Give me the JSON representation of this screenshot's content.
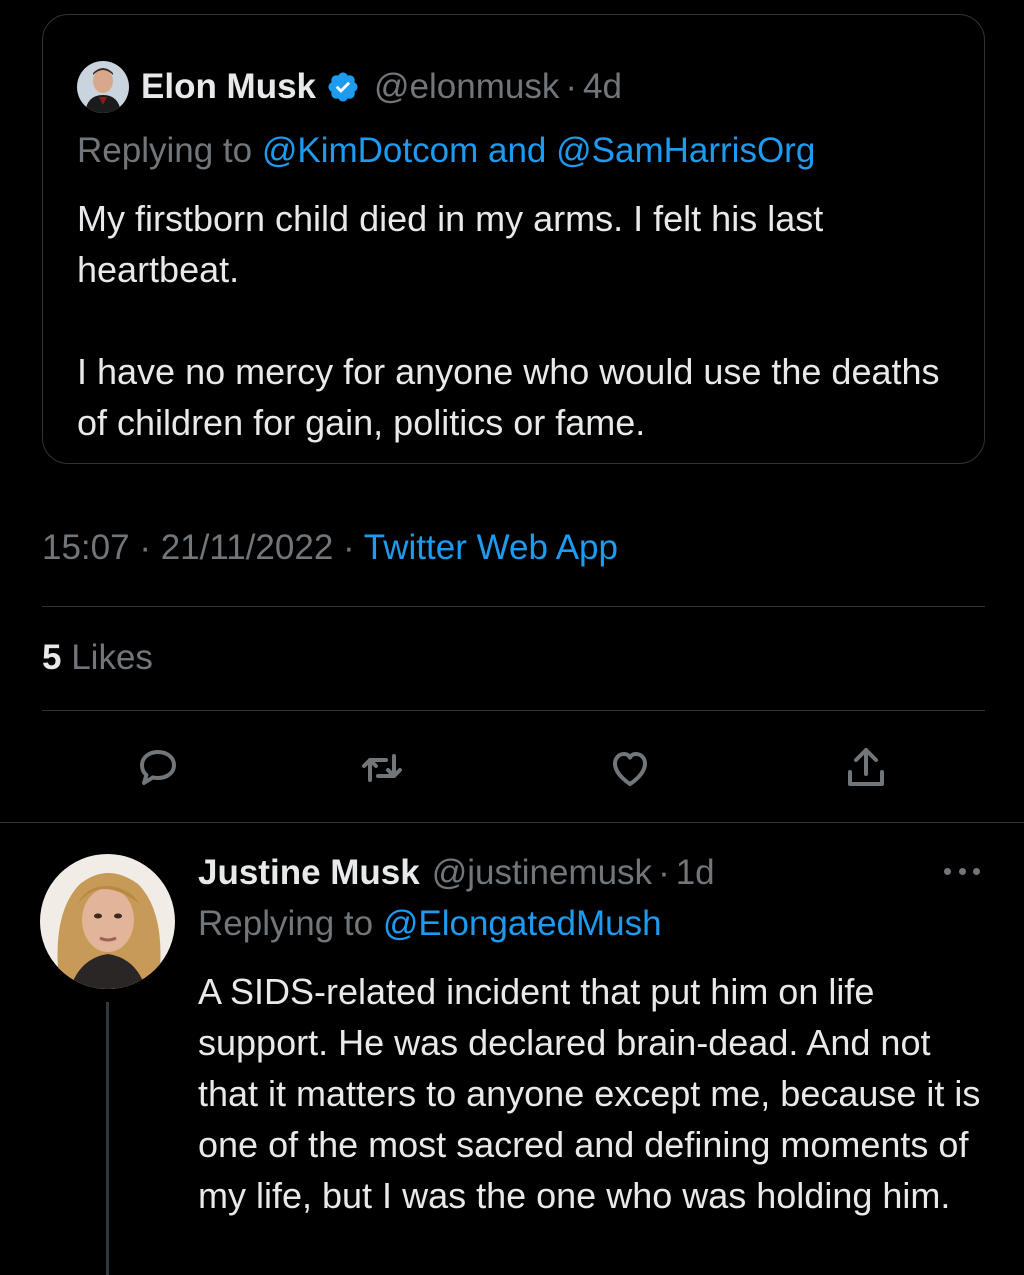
{
  "quoted_tweet": {
    "author_name": "Elon Musk",
    "handle": "@elonmusk",
    "separator": "·",
    "time_ago": "4d",
    "replying_prefix": "Replying to",
    "replying_to_1": "@KimDotcom",
    "replying_and": "and",
    "replying_to_2": "@SamHarrisOrg",
    "paragraph_1": "My firstborn child died in my arms. I felt his last heartbeat.",
    "paragraph_2": "I have no mercy for anyone who would use the deaths of children for gain, politics or fame."
  },
  "tweet_meta": {
    "time": "15:07",
    "date": "21/11/2022",
    "separator": "·",
    "source": "Twitter Web App",
    "likes_count": "5",
    "likes_label": "Likes"
  },
  "actions": [
    "reply-icon",
    "retweet-icon",
    "like-icon",
    "share-icon"
  ],
  "reply_tweet": {
    "author_name": "Justine Musk",
    "handle": "@justinemusk",
    "separator": "·",
    "time_ago": "1d",
    "replying_prefix": "Replying to",
    "replying_to": "@ElongatedMush",
    "body": "A SIDS-related incident that put him on life support. He was declared brain-dead. And not that it matters to anyone except me, because it is one of the most sacred and defining moments of my life, but I was the one who was holding him."
  },
  "colors": {
    "background": "#000000",
    "primary_text": "#e7e9ea",
    "secondary_text": "#71767b",
    "link": "#1d9bf0",
    "border": "#2f3336"
  }
}
